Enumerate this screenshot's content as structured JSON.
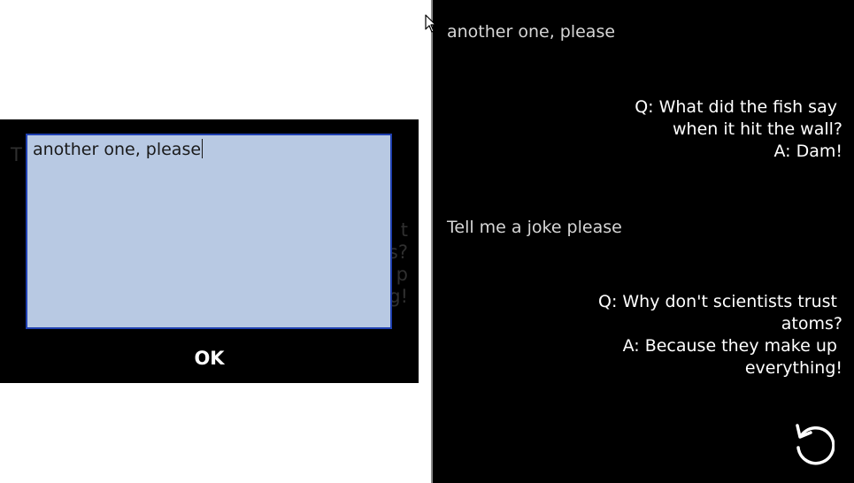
{
  "dialog": {
    "input_value": "another one, please",
    "ok_label": "OK",
    "background_text_left": "T",
    "background_text_right": "t\ns?\np\ng!"
  },
  "chat": {
    "messages": [
      {
        "role": "user",
        "text": "another one, please"
      },
      {
        "role": "bot",
        "lines": [
          "Q: What did the fish say ",
          "when it hit the wall?",
          "A: Dam!"
        ]
      },
      {
        "role": "user",
        "text": "Tell me a joke please"
      },
      {
        "role": "bot",
        "lines": [
          "Q: Why don't scientists trust ",
          "atoms?",
          "A: Because they make up ",
          "everything!"
        ]
      }
    ],
    "refresh_icon": "refresh-icon"
  },
  "colors": {
    "panel_bg": "#000000",
    "input_bg": "#b8c9e3",
    "input_border": "#1f3fb0",
    "user_text": "#d6d6d6",
    "bot_text": "#ffffff"
  }
}
